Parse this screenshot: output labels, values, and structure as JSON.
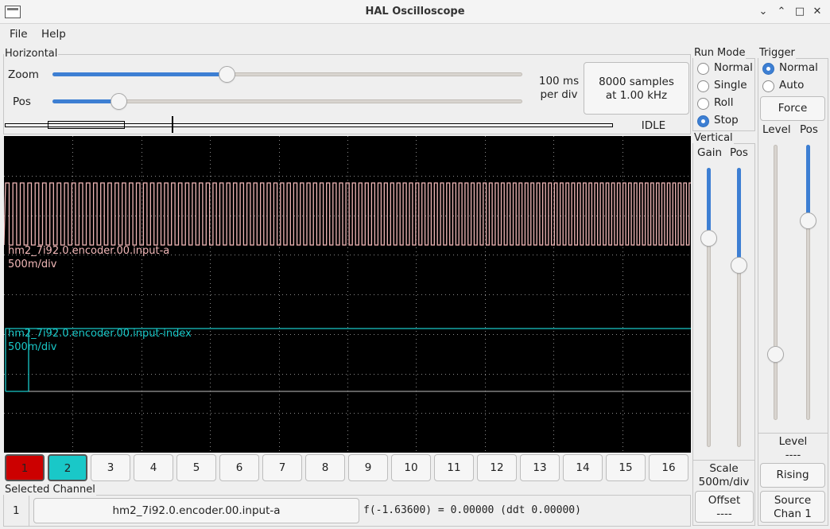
{
  "window": {
    "title": "HAL Oscilloscope",
    "controls": {
      "minimize": "⌄",
      "restore": "⌃",
      "maximize": "□",
      "close": "✕"
    }
  },
  "menu": {
    "file": "File",
    "help": "Help"
  },
  "horizontal": {
    "title": "Horizontal",
    "zoom_label": "Zoom",
    "pos_label": "Pos",
    "zoom_level": 0.37,
    "pos_level": 0.14,
    "scale_line1": "100 ms",
    "scale_line2": "per div",
    "samples_line1": "8000 samples",
    "samples_line2": "at 1.00 kHz",
    "status": "IDLE"
  },
  "run_mode": {
    "title": "Run Mode",
    "options": [
      "Normal",
      "Single",
      "Roll",
      "Stop"
    ],
    "selected": "Stop"
  },
  "trigger": {
    "title": "Trigger",
    "options": [
      "Normal",
      "Auto"
    ],
    "selected": "Normal",
    "force_label": "Force",
    "level_label": "Level",
    "pos_label": "Pos",
    "level_value_label": "Level",
    "level_value": "----",
    "edge_label": "Rising",
    "source_line1": "Source",
    "source_line2": "Chan  1"
  },
  "vertical": {
    "title": "Vertical",
    "gain_label": "Gain",
    "pos_label": "Pos",
    "scale_label": "Scale",
    "scale_value": "500m/div",
    "offset_label": "Offset",
    "offset_value": "----"
  },
  "traces": [
    {
      "name": "hm2_7i92.0.encoder.00.input-a",
      "scale": "500m/div",
      "color": "#f2b8b8"
    },
    {
      "name": "hm2_7i92.0.encoder.00.input-index",
      "scale": "500m/div",
      "color": "#19c8c8"
    }
  ],
  "channels": [
    "1",
    "2",
    "3",
    "4",
    "5",
    "6",
    "7",
    "8",
    "9",
    "10",
    "11",
    "12",
    "13",
    "14",
    "15",
    "16"
  ],
  "channel_colors": {
    "1": "#cc0000",
    "2": "#19c8c8"
  },
  "selected_channel": {
    "title": "Selected Channel",
    "number": "1",
    "name": "hm2_7i92.0.encoder.00.input-a",
    "readout": "f(-1.63600) =  0.00000 (ddt  0.00000)"
  },
  "colors": {
    "accent": "#3d7fd3",
    "scope_bg": "#000000",
    "grid": "#8a8a8a"
  }
}
